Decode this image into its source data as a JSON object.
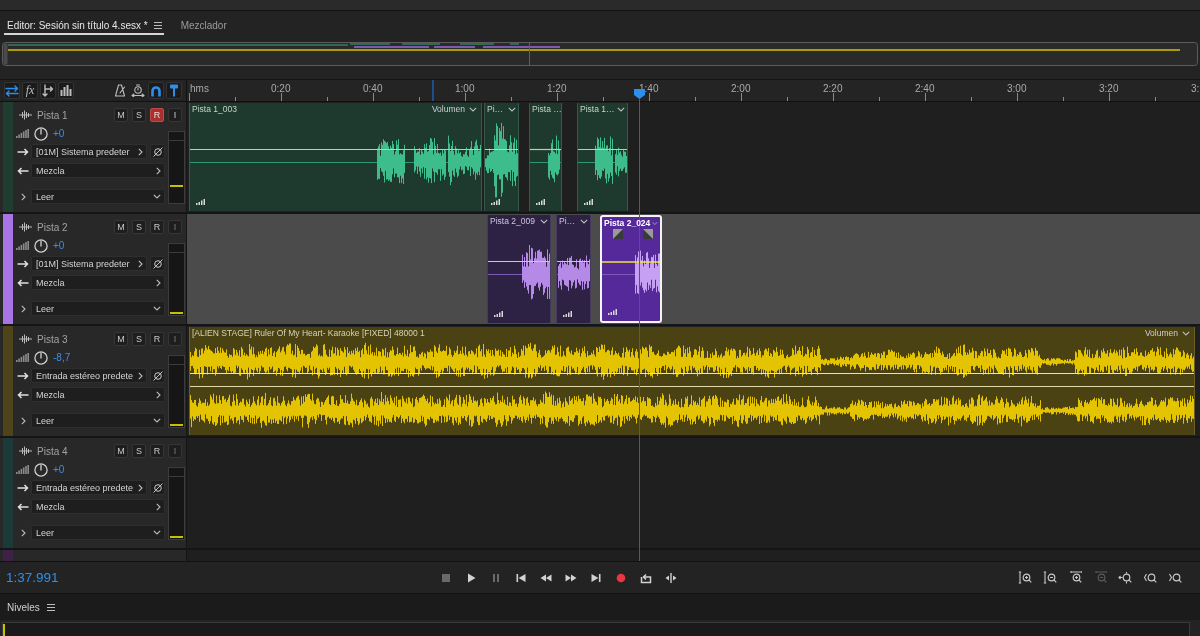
{
  "tabs": [
    {
      "label": "Editor: Sesión sin título 4.sesx *",
      "selected": true,
      "menu": true
    },
    {
      "label": "Mezclador",
      "selected": false,
      "menu": false
    }
  ],
  "header_tools": [
    {
      "kind": "switch",
      "on": true
    },
    {
      "kind": "effects",
      "label": "fx",
      "on": false
    },
    {
      "kind": "sends",
      "on": false
    },
    {
      "kind": "eq",
      "on": false
    },
    {
      "kind": "metronome",
      "on": false
    },
    {
      "kind": "timer",
      "on": false
    },
    {
      "kind": "snap",
      "on": true
    },
    {
      "kind": "pin",
      "on": true
    }
  ],
  "ruler": {
    "unit": "hms",
    "labels": [
      "0:20",
      "0:40",
      "1:00",
      "1:20",
      "1:40",
      "2:00",
      "2:20",
      "2:40",
      "3:00",
      "3:20",
      "3:"
    ]
  },
  "tracks": [
    {
      "kind": "full",
      "name": "Pista 1",
      "color": "#1f3d31",
      "selected": false,
      "buttons": [
        {
          "kind": "mute",
          "label": "M",
          "on": false,
          "disabled": false
        },
        {
          "kind": "solo",
          "label": "S",
          "on": false,
          "disabled": false
        },
        {
          "kind": "arm",
          "label": "R",
          "on": true,
          "disabled": false
        },
        {
          "kind": "monitor",
          "label": "I",
          "on": false,
          "disabled": false
        }
      ],
      "volume": {
        "value": "+0"
      },
      "input": "[01M] Sistema predeter",
      "output": "Mezcla",
      "automation": "Leer",
      "expanded": false,
      "meter": {
        "level": 0.27
      },
      "clips": [
        {
          "kind": "mono",
          "name": "Pista 1_003",
          "envelope": "Volumen",
          "selected": false
        },
        {
          "kind": "mono",
          "name": "Pi…",
          "menu": true,
          "selected": false
        },
        {
          "kind": "mono",
          "name": "Pista …",
          "menu": false,
          "selected": false
        },
        {
          "kind": "mono",
          "name": "Pista 1…",
          "menu": true,
          "selected": false
        }
      ]
    },
    {
      "kind": "full",
      "name": "Pista 2",
      "color": "#a874e6",
      "selected": true,
      "buttons": [
        {
          "kind": "mute",
          "label": "M",
          "on": false,
          "disabled": false
        },
        {
          "kind": "solo",
          "label": "S",
          "on": false,
          "disabled": false
        },
        {
          "kind": "arm",
          "label": "R",
          "on": false,
          "disabled": false
        },
        {
          "kind": "monitor",
          "label": "I",
          "on": false,
          "disabled": true
        }
      ],
      "volume": {
        "value": "+0"
      },
      "input": "[01M] Sistema predeter",
      "output": "Mezcla",
      "automation": "Leer",
      "expanded": false,
      "meter": {
        "level": 0.02
      },
      "clips": [
        {
          "kind": "mono",
          "name": "Pista 2_009",
          "menu": true,
          "selected": false
        },
        {
          "kind": "mono",
          "name": "Pi…",
          "menu": true,
          "selected": false
        },
        {
          "kind": "mono",
          "name": "Pista 2_024",
          "menu": true,
          "selected": true
        }
      ]
    },
    {
      "kind": "full",
      "name": "Pista 3",
      "color": "#4d4419",
      "selected": false,
      "buttons": [
        {
          "kind": "mute",
          "label": "M",
          "on": false,
          "disabled": false
        },
        {
          "kind": "solo",
          "label": "S",
          "on": false,
          "disabled": false
        },
        {
          "kind": "arm",
          "label": "R",
          "on": false,
          "disabled": false
        },
        {
          "kind": "monitor",
          "label": "I",
          "on": false,
          "disabled": true
        }
      ],
      "volume": {
        "value": "-8,7"
      },
      "input": "Entrada estéreo predete",
      "output": "Mezcla",
      "automation": "Leer",
      "expanded": false,
      "meter": {
        "level": 0.02
      },
      "clips": [
        {
          "kind": "stereo",
          "name": "[ALIEN STAGE] Ruler Of My Heart- Karaoke [FIXED] 48000 1",
          "envelope": "Volumen",
          "selected": false
        }
      ]
    },
    {
      "kind": "full",
      "name": "Pista 4",
      "color": "#1c3a38",
      "selected": false,
      "buttons": [
        {
          "kind": "mute",
          "label": "M",
          "on": false,
          "disabled": false
        },
        {
          "kind": "solo",
          "label": "S",
          "on": false,
          "disabled": false
        },
        {
          "kind": "arm",
          "label": "R",
          "on": false,
          "disabled": false
        },
        {
          "kind": "monitor",
          "label": "I",
          "on": false,
          "disabled": true
        }
      ],
      "volume": {
        "value": "+0"
      },
      "input": "Entrada estéreo predete",
      "output": "Mezcla",
      "automation": "Leer",
      "expanded": false,
      "meter": {
        "level": 0.02
      }
    },
    {
      "kind": "partial",
      "color": "#3c2346"
    }
  ],
  "transport": {
    "time": "1:37.991",
    "buttons": [
      {
        "kind": "stop",
        "disabled": true
      },
      {
        "kind": "play",
        "disabled": false
      },
      {
        "kind": "pause",
        "disabled": true
      },
      {
        "kind": "start",
        "disabled": false
      },
      {
        "kind": "rewind",
        "disabled": false
      },
      {
        "kind": "forward",
        "disabled": false
      },
      {
        "kind": "end",
        "disabled": false
      },
      {
        "kind": "record",
        "disabled": false
      },
      {
        "kind": "loop",
        "disabled": false
      },
      {
        "kind": "skip",
        "disabled": false
      }
    ],
    "zoom": [
      {
        "kind": "amp-in",
        "disabled": false
      },
      {
        "kind": "amp-out",
        "disabled": false
      },
      {
        "kind": "time-in",
        "disabled": false
      },
      {
        "kind": "time-out",
        "disabled": true
      },
      {
        "kind": "selection",
        "disabled": false
      },
      {
        "kind": "in-left",
        "disabled": false
      },
      {
        "kind": "in-right",
        "disabled": false
      }
    ]
  },
  "levels_panel": {
    "title": "Niveles",
    "menu": true,
    "meter": {
      "level": 0
    }
  }
}
